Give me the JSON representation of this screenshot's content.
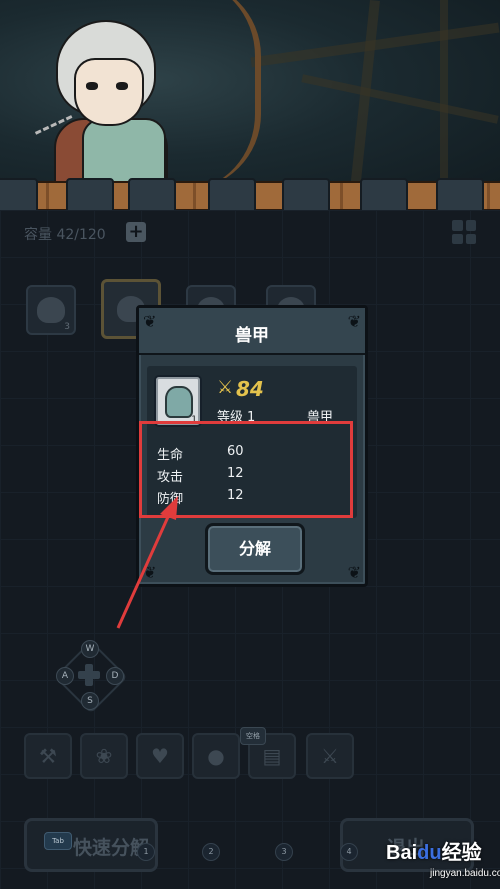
{
  "inventory": {
    "capacity_text": "容量 42/120",
    "add_icon": "plus-icon",
    "layout_icon": "grid-layout-icon"
  },
  "dialog": {
    "title": "兽甲",
    "item": {
      "count": "1",
      "power": "84",
      "power_icon": "sword-icon",
      "level_label": "等级",
      "level_value": "1",
      "type": "兽甲"
    },
    "stats": [
      {
        "label": "生命",
        "value": "60"
      },
      {
        "label": "攻击",
        "value": "12"
      },
      {
        "label": "防御",
        "value": "12"
      }
    ],
    "decompose_label": "分解"
  },
  "dpad": {
    "up": "W",
    "left": "A",
    "right": "D",
    "down": "S"
  },
  "toolbar": {
    "space_badge": "空格",
    "items": [
      "hammer-sword-icon",
      "paw-icon",
      "heart-icon",
      "potion-icon",
      "chest-icon",
      "sword-icon"
    ]
  },
  "bottom": {
    "tab_badge": "Tab",
    "quick_decompose_label": "快速分解",
    "exit_label": "退出",
    "pages": [
      "1",
      "2",
      "3",
      "4"
    ]
  },
  "watermark": {
    "brand_left": "Bai",
    "brand_mid": "du",
    "brand_right": "经验",
    "url": "jingyan.baidu.com"
  },
  "colors": {
    "highlight": "#e03c3c",
    "power": "#e3c24d",
    "dialog_bg": "#2c3b44"
  }
}
